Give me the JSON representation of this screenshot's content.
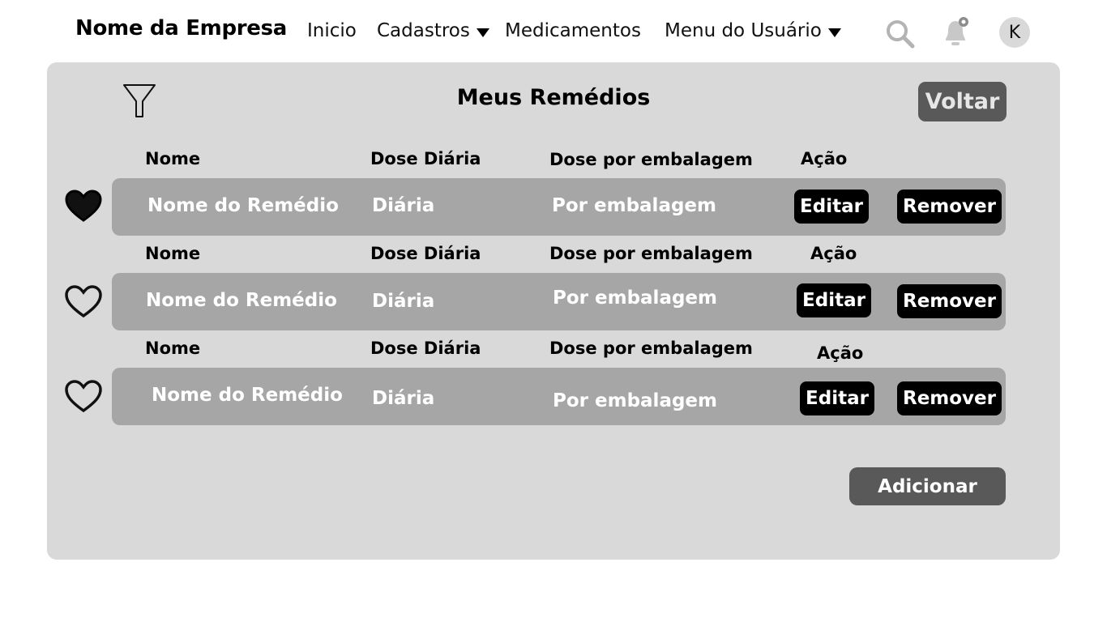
{
  "nav": {
    "brand": "Nome da Empresa",
    "items": [
      {
        "label": "Inicio"
      },
      {
        "label": "Cadastros"
      },
      {
        "label": "Medicamentos"
      },
      {
        "label": "Menu do Usuário"
      }
    ],
    "avatar_letter": "K",
    "icons": {
      "search": "search-icon",
      "notifications": "bell-icon",
      "filter": "filter-icon",
      "favorite": "heart-icon"
    }
  },
  "panel": {
    "title": "Meus Remédios",
    "back_label": "Voltar",
    "add_label": "Adicionar"
  },
  "columns": {
    "name": "Nome",
    "daily": "Dose Diária",
    "per_pack": "Dose por embalagem",
    "action": "Ação"
  },
  "rows": [
    {
      "name": "Nome do Remédio",
      "daily": "Diária",
      "per_pack": "Por embalagem",
      "edit": "Editar",
      "remove": "Remover",
      "favorite": true
    },
    {
      "name": "Nome do Remédio",
      "daily": "Diária",
      "per_pack": "Por embalagem",
      "edit": "Editar",
      "remove": "Remover",
      "favorite": false
    },
    {
      "name": "Nome do Remédio",
      "daily": "Diária",
      "per_pack": "Por embalagem",
      "edit": "Editar",
      "remove": "Remover",
      "favorite": false
    }
  ],
  "colors": {
    "panel": "#d9d9d9",
    "row": "#a6a6a6",
    "button_gray": "#595959",
    "button_dark": "#000000"
  }
}
